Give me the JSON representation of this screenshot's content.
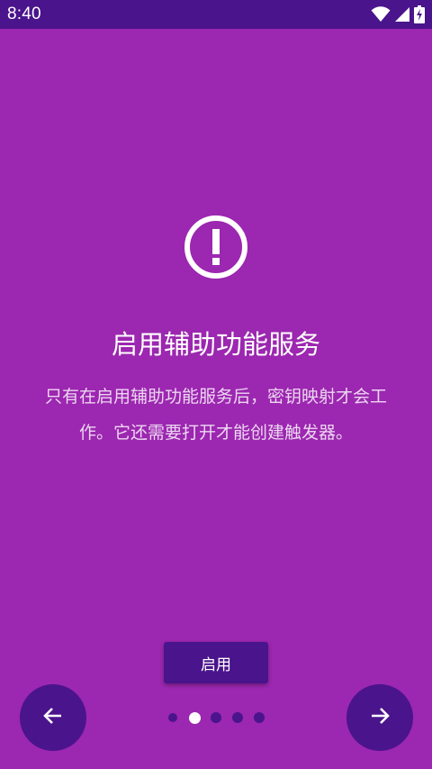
{
  "status_bar": {
    "time": "8:40",
    "icons": [
      "wifi-icon",
      "cell-signal-icon",
      "battery-charging-icon"
    ]
  },
  "main": {
    "icon": "alert-circle-icon",
    "title": "启用辅助功能服务",
    "description_line1": "只有在启用辅助功能服务后，密钥映射才会工",
    "description_line2": "作。它还需要打开才能创建触发器。",
    "enable_button_label": "启用"
  },
  "navigation": {
    "prev_icon": "arrow-left-icon",
    "next_icon": "arrow-right-icon",
    "page_count": 5,
    "current_page": 2
  },
  "colors": {
    "background": "#9c27b0",
    "dark_accent": "#4a148c",
    "text": "#ffffff",
    "active_dot": "#ffffff"
  }
}
